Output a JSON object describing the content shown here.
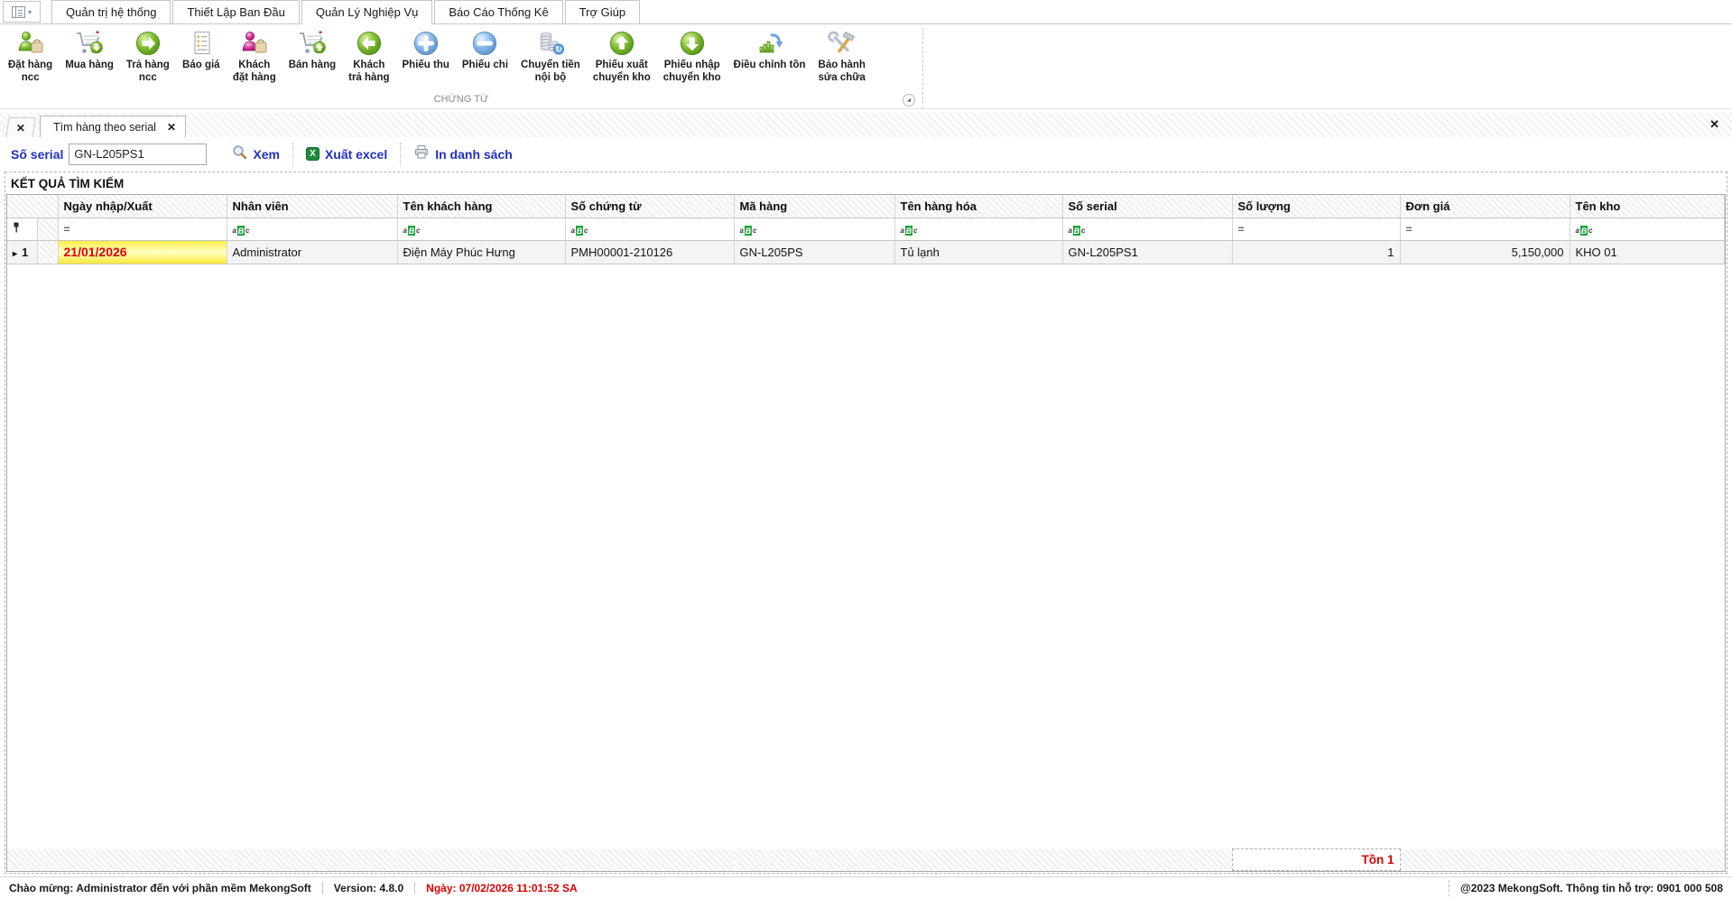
{
  "icons": {
    "caret_down": "▾",
    "close_x": "✕",
    "tab_close_x": "✕",
    "expand_glyph": "◢",
    "row_arrow": "▸",
    "excel_x": "X"
  },
  "menubar": {
    "tabs": [
      "Quản trị hệ thống",
      "Thiết Lập Ban Đầu",
      "Quản Lý Nghiệp Vụ",
      "Báo Cáo Thống Kê",
      "Trợ Giúp"
    ]
  },
  "ribbon": {
    "group_label": "CHỨNG TỪ",
    "items": [
      {
        "label": "Đặt hàng\nncc",
        "icon": "supplier-order-icon"
      },
      {
        "label": "Mua hàng",
        "icon": "purchase-cart-icon"
      },
      {
        "label": "Trả hàng\nncc",
        "icon": "return-supplier-icon"
      },
      {
        "label": "Báo giá",
        "icon": "quotation-document-icon"
      },
      {
        "label": "Khách\nđặt hàng",
        "icon": "customer-order-icon"
      },
      {
        "label": "Bán hàng",
        "icon": "sales-cart-icon"
      },
      {
        "label": "Khách\ntrả hàng",
        "icon": "customer-return-icon"
      },
      {
        "label": "Phiếu thu",
        "icon": "receipt-plus-icon"
      },
      {
        "label": "Phiếu chi",
        "icon": "payment-minus-icon"
      },
      {
        "label": "Chuyển tiền\nnội bộ",
        "icon": "internal-transfer-icon"
      },
      {
        "label": "Phiếu xuất\nchuyển kho",
        "icon": "warehouse-out-icon"
      },
      {
        "label": "Phiếu nhập\nchuyển kho",
        "icon": "warehouse-in-icon"
      },
      {
        "label": "Điều chỉnh tồn",
        "icon": "stock-adjust-icon"
      },
      {
        "label": "Bảo hành\nsửa chữa",
        "icon": "repair-tools-icon"
      }
    ]
  },
  "tabstrip": {
    "document_tab": "Tìm hàng theo serial"
  },
  "toolbar": {
    "serial_label": "Số serial",
    "serial_value": "GN-L205PS1",
    "view_label": "Xem",
    "export_label": "Xuất excel",
    "print_label": "In danh sách"
  },
  "results": {
    "title": "KẾT QUẢ TÌM KIẾM"
  },
  "grid": {
    "columns": [
      "Ngày nhập/Xuất",
      "Nhân viên",
      "Tên khách hàng",
      "Số chứng từ",
      "Mã hàng",
      "Tên hàng hóa",
      "Số serial",
      "Số lượng",
      "Đơn giá",
      "Tên kho"
    ],
    "filter": {
      "eq": "=",
      "a": "a",
      "b": "B",
      "c": "c"
    },
    "rows": [
      {
        "num": "1",
        "date": "21/01/2026",
        "employee": "Administrator",
        "customer": "Điện Máy Phúc Hưng",
        "doc_no": "PMH00001-210126",
        "item_code": "GN-L205PS",
        "item_name": "Tủ lạnh",
        "serial": "GN-L205PS1",
        "qty": "1",
        "unit_price": "5,150,000",
        "warehouse": "KHO 01"
      }
    ],
    "footer": {
      "qty_summary": "Tồn 1"
    }
  },
  "statusbar": {
    "welcome": "Chào mừng: Administrator đến với phần mềm MekongSoft",
    "version": "Version: 4.8.0",
    "date": "Ngày: 07/02/2026 11:01:52 SA",
    "copyright": "@2023 MekongSoft. Thông tin hỗ trợ: 0901 000 508"
  }
}
